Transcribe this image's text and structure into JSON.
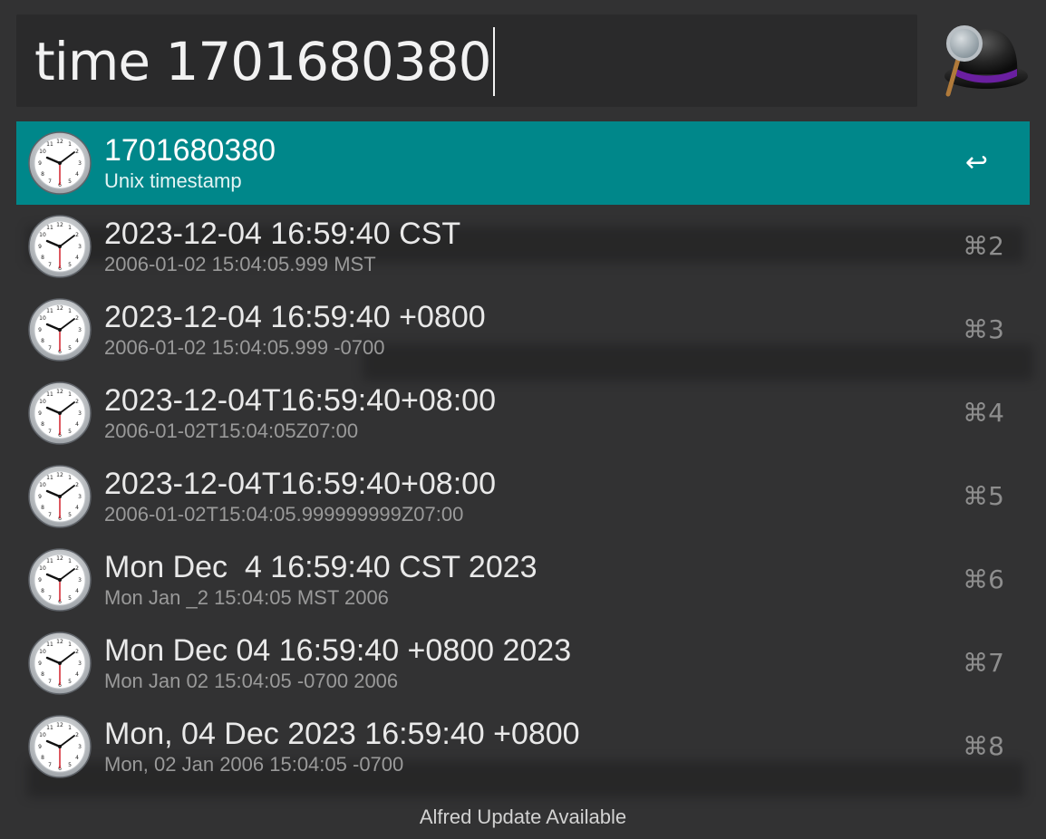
{
  "search": {
    "query": "time 1701680380"
  },
  "results": [
    {
      "title": "1701680380",
      "subtitle": "Unix timestamp",
      "shortcut": "↩",
      "selected": true
    },
    {
      "title": "2023-12-04 16:59:40 CST",
      "subtitle": "2006-01-02 15:04:05.999 MST",
      "shortcut": "⌘2"
    },
    {
      "title": "2023-12-04 16:59:40 +0800",
      "subtitle": "2006-01-02 15:04:05.999 -0700",
      "shortcut": "⌘3"
    },
    {
      "title": "2023-12-04T16:59:40+08:00",
      "subtitle": "2006-01-02T15:04:05Z07:00",
      "shortcut": "⌘4"
    },
    {
      "title": "2023-12-04T16:59:40+08:00",
      "subtitle": "2006-01-02T15:04:05.999999999Z07:00",
      "shortcut": "⌘5"
    },
    {
      "title": "Mon Dec  4 16:59:40 CST 2023",
      "subtitle": "Mon Jan _2 15:04:05 MST 2006",
      "shortcut": "⌘6"
    },
    {
      "title": "Mon Dec 04 16:59:40 +0800 2023",
      "subtitle": "Mon Jan 02 15:04:05 -0700 2006",
      "shortcut": "⌘7"
    },
    {
      "title": "Mon, 04 Dec 2023 16:59:40 +0800",
      "subtitle": "Mon, 02 Jan 2006 15:04:05 -0700",
      "shortcut": "⌘8"
    }
  ],
  "footer": {
    "text": "Alfred Update Available"
  },
  "icons": {
    "app_logo": "alfred-hat-icon",
    "result_icon": "clock-icon"
  },
  "colors": {
    "selected_row": "#00878a",
    "background": "#323233",
    "search_background": "#2a2a2b"
  }
}
